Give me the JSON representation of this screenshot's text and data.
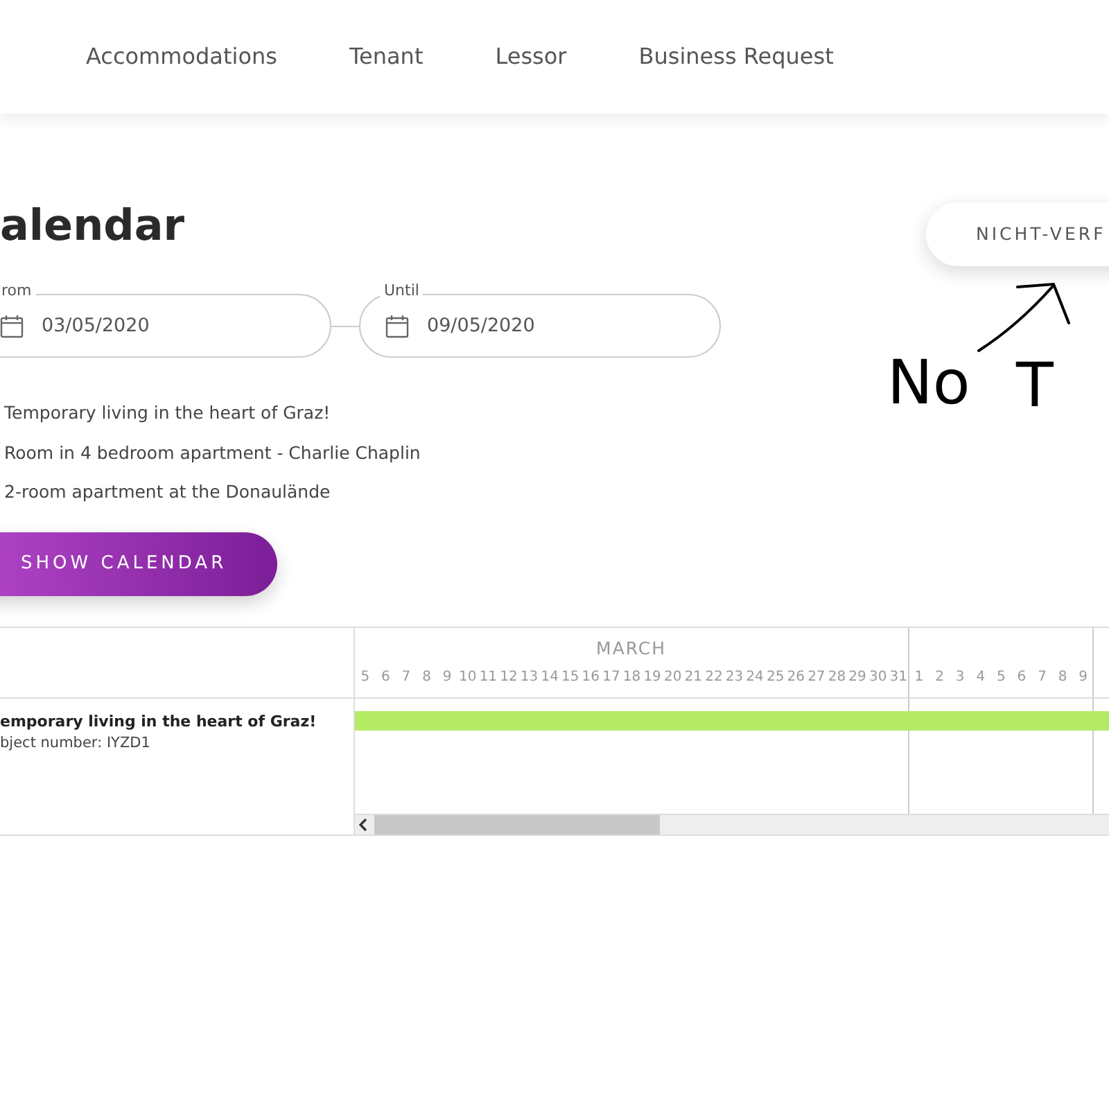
{
  "nav": {
    "items": [
      "Accommodations",
      "Tenant",
      "Lessor",
      "Business Request"
    ]
  },
  "title": "alendar",
  "status_button": "NICHT-VERF",
  "date_range": [
    {
      "label": "rom",
      "value": "03/05/2020"
    },
    {
      "label": "Until",
      "value": "09/05/2020"
    }
  ],
  "listings": [
    "Temporary living in the heart of Graz!",
    "Room in 4 bedroom apartment - Charlie Chaplin",
    "2-room apartment at the Donaulände"
  ],
  "show_button": "SHOW CALENDAR",
  "timeline": {
    "months": [
      {
        "name": "MARCH",
        "days": [
          "5",
          "6",
          "7",
          "8",
          "9",
          "10",
          "11",
          "12",
          "13",
          "14",
          "15",
          "16",
          "17",
          "18",
          "19",
          "20",
          "21",
          "22",
          "23",
          "24",
          "25",
          "26",
          "27",
          "28",
          "29",
          "30",
          "31"
        ]
      },
      {
        "days": [
          "1",
          "2",
          "3",
          "4",
          "5",
          "6",
          "7",
          "8",
          "9"
        ]
      }
    ],
    "rows": [
      {
        "title": "emporary living in the heart of Graz!",
        "subtitle": "bject number: IYZD1",
        "occupied": true
      }
    ]
  },
  "annotation": [
    {
      "text": "No"
    },
    {
      "text": "T"
    }
  ]
}
